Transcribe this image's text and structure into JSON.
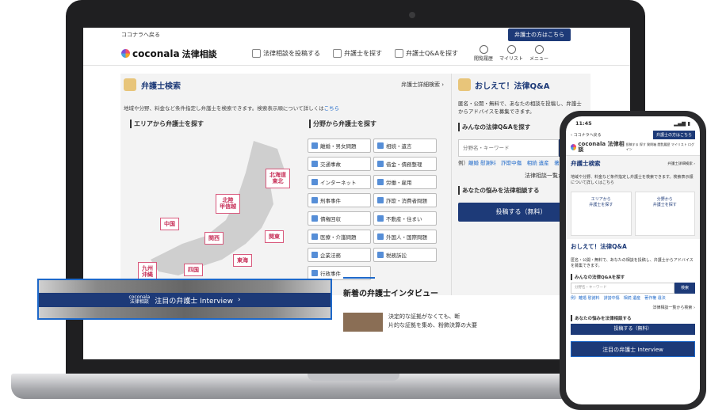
{
  "header": {
    "back": "ココナラへ戻る",
    "pro_button": "弁護士の方はこちら",
    "brand": "coconala",
    "brand_sub": "法律相談",
    "nav": [
      "法律相談を投稿する",
      "弁護士を探す",
      "弁護士Q&Aを探す"
    ],
    "utils": [
      "閲覧履歴",
      "マイリスト",
      "メニュー"
    ]
  },
  "search_panel": {
    "title": "弁護士検索",
    "advanced": "弁護士詳細検索 ›",
    "desc": "地域や分野、料金など条件指定し弁護士を検索できます。検索表示順について詳しくは",
    "desc_link": "こちら",
    "area_heading": "エリアから弁護士を探す",
    "field_heading": "分野から弁護士を探す",
    "regions": {
      "hokkaido": "北海道\n東北",
      "hokuriku": "北陸\n甲信越",
      "chugoku": "中国",
      "kansai": "関西",
      "kanto": "関東",
      "tokai": "東海",
      "kyushu": "九州\n沖縄",
      "shikoku": "四国"
    },
    "fields": [
      "離婚・男女問題",
      "相続・遺言",
      "交通事故",
      "借金・債務整理",
      "インターネット",
      "労働・雇用",
      "刑事事件",
      "詐欺・消費者問題",
      "債権回収",
      "不動産・住まい",
      "医療・介護問題",
      "外国人・国際問題",
      "企業法務",
      "税務訴訟",
      "行政事件"
    ]
  },
  "qa_panel": {
    "title": "おしえて！法律Q&A",
    "desc": "匿名・公開・無料で、あなたの相談を投稿し、弁護士からアドバイスを募集できます。",
    "search_heading": "みんなの法律Q&Aを探す",
    "placeholder": "分野名・キーワード",
    "search_button": "検索",
    "tags_prefix": "例）",
    "tags": "離婚 慰謝料　詐欺中傷　相続 遺産　著作権 違法",
    "list_link": "法律相談一覧から検索 ›",
    "post_heading": "あなたの悩みを法律相談する",
    "post_button": "投稿する（無料）"
  },
  "banner": {
    "logo": "coconala\n法律相談",
    "text": "注目の弁護士 Interview"
  },
  "interview": {
    "heading": "新着の弁護士インタビュー",
    "snippet": "決定的な証拠がなくても、断\n片的な証拠を集め、粉飾決算の大要"
  },
  "phone": {
    "time": "11:45",
    "back": "‹ ココナラへ戻る",
    "pro": "弁護士の方はこちら",
    "brand": "coconala 法律相談",
    "nav": "投稿する 探す 質問箱 閲覧履歴 マイリスト ログイン",
    "search_title": "弁護士検索",
    "adv": "弁護士詳細検索 ›",
    "desc": "地域や分野、料金など条件指定し弁護士を検索できます。検索表示順について詳しくはこちら",
    "card1": "エリアから\n弁護士を探す",
    "card2": "分野から\n弁護士を探す",
    "qa_title": "おしえて！法律Q&A",
    "qa_desc": "匿名・公開・無料で、あなたの相談を投稿し、弁護士からアドバイスを募集できます。",
    "qa_h": "みんなの法律Q&Aを探す",
    "placeholder": "分野名・キーワード",
    "search": "検索",
    "tags": "例）離婚 慰謝料　誹謗中傷　相続 遺産　著作権 違法",
    "list": "法律相談一覧から検索 ›",
    "post_h": "あなたの悩みを法律相談する",
    "post": "投稿する（無料）",
    "banner": "注目の弁護士 Interview"
  }
}
